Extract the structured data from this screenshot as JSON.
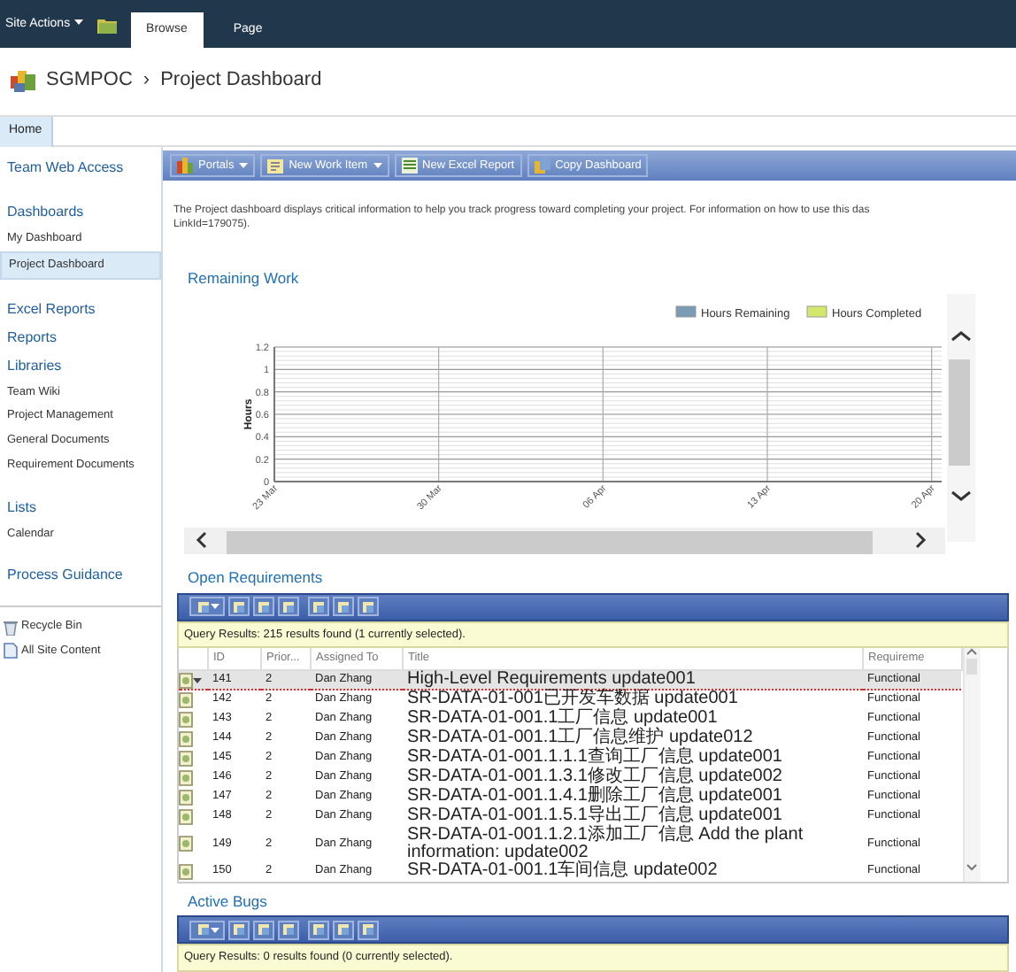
{
  "top_bar": {
    "site_actions": "Site Actions",
    "tabs": [
      {
        "label": "Browse",
        "selected": true
      },
      {
        "label": "Page",
        "selected": false
      }
    ]
  },
  "breadcrumb": {
    "site": "SGMPOC",
    "separator": "›",
    "page": "Project Dashboard"
  },
  "top_nav": [
    {
      "label": "Home",
      "selected": true
    }
  ],
  "sidebar": {
    "groups": [
      [
        {
          "label": "Team Web Access",
          "kind": "heading"
        }
      ],
      [
        {
          "label": "Dashboards",
          "kind": "heading"
        },
        {
          "label": "My Dashboard",
          "kind": "link",
          "selected": false
        },
        {
          "label": "Project Dashboard",
          "kind": "link",
          "selected": true
        }
      ],
      [
        {
          "label": "Excel Reports",
          "kind": "heading"
        },
        {
          "label": "Reports",
          "kind": "heading"
        },
        {
          "label": "Libraries",
          "kind": "heading"
        },
        {
          "label": "Team Wiki",
          "kind": "link",
          "selected": false
        },
        {
          "label": "Project Management",
          "kind": "link",
          "selected": false
        },
        {
          "label": "General Documents",
          "kind": "link",
          "selected": false
        },
        {
          "label": "Requirement Documents",
          "kind": "link",
          "selected": false
        }
      ],
      [
        {
          "label": "Lists",
          "kind": "heading"
        },
        {
          "label": "Calendar",
          "kind": "link",
          "selected": false
        }
      ],
      [
        {
          "label": "Process Guidance",
          "kind": "heading"
        }
      ]
    ],
    "footer": [
      {
        "label": "Recycle Bin",
        "kind": "recycle"
      },
      {
        "label": "All Site Content",
        "kind": "content"
      }
    ]
  },
  "toolbar": [
    {
      "label": "Portals",
      "dropdown": true,
      "kind": "portals"
    },
    {
      "label": "New Work Item",
      "dropdown": true,
      "kind": "workitem"
    },
    {
      "label": "New Excel Report",
      "dropdown": false,
      "kind": "excel"
    },
    {
      "label": "Copy Dashboard",
      "dropdown": false,
      "kind": "copy"
    }
  ],
  "description": [
    "The Project dashboard displays critical information to help you track progress toward completing your project. For information on how to use this das",
    "LinkId=179075)."
  ],
  "remaining_work": {
    "title": "Remaining Work",
    "chart_data": {
      "type": "line",
      "grid": true,
      "ylabel": "Hours",
      "categories": [
        "23 Mar",
        "30 Mar",
        "06 Apr",
        "13 Apr",
        "20 Apr"
      ],
      "ylim": [
        0,
        1.2
      ],
      "yticks": [
        0,
        0.2,
        0.4,
        0.6,
        0.8,
        1,
        1.2
      ],
      "series": [
        {
          "name": "Hours Remaining",
          "color": "#7b9cb4",
          "values": [
            null,
            null,
            null,
            null,
            null
          ]
        },
        {
          "name": "Hours Completed",
          "color": "#d4e66c",
          "values": [
            null,
            null,
            null,
            null,
            null
          ]
        }
      ]
    }
  },
  "open_requirements": {
    "title": "Open Requirements",
    "query_results": "Query Results: 215 results found (1 currently selected).",
    "columns": [
      "ID",
      "Prior...",
      "Assigned To",
      "Title",
      "Requireme"
    ],
    "rows": [
      {
        "cells": [
          "141",
          "2",
          "Dan Zhang",
          "High-Level Requirements update001",
          "Functional"
        ],
        "selected": true
      },
      {
        "cells": [
          "142",
          "2",
          "Dan Zhang",
          "SR-DATA-01-001已开发车数据 update001",
          "Functional"
        ],
        "selected": false
      },
      {
        "cells": [
          "143",
          "2",
          "Dan Zhang",
          "SR-DATA-01-001.1工厂信息 update001",
          "Functional"
        ],
        "selected": false
      },
      {
        "cells": [
          "144",
          "2",
          "Dan Zhang",
          "SR-DATA-01-001.1工厂信息维护 update012",
          "Functional"
        ],
        "selected": false
      },
      {
        "cells": [
          "145",
          "2",
          "Dan Zhang",
          "SR-DATA-01-001.1.1.1查询工厂信息 update001",
          "Functional"
        ],
        "selected": false
      },
      {
        "cells": [
          "146",
          "2",
          "Dan Zhang",
          "SR-DATA-01-001.1.3.1修改工厂信息 update002",
          "Functional"
        ],
        "selected": false
      },
      {
        "cells": [
          "147",
          "2",
          "Dan Zhang",
          "SR-DATA-01-001.1.4.1删除工厂信息 update001",
          "Functional"
        ],
        "selected": false
      },
      {
        "cells": [
          "148",
          "2",
          "Dan Zhang",
          "SR-DATA-01-001.1.5.1导出工厂信息 update001",
          "Functional"
        ],
        "selected": false
      },
      {
        "cells": [
          "149",
          "2",
          "Dan Zhang",
          "SR-DATA-01-001.1.2.1添加工厂信息 Add the plant information: update002",
          "Functional"
        ],
        "selected": false
      },
      {
        "cells": [
          "150",
          "2",
          "Dan Zhang",
          "SR-DATA-01-001.1车间信息 update002",
          "Functional"
        ],
        "selected": false
      }
    ]
  },
  "active_bugs": {
    "title": "Active Bugs",
    "query_results": "Query Results: 0 results found (0 currently selected)."
  }
}
